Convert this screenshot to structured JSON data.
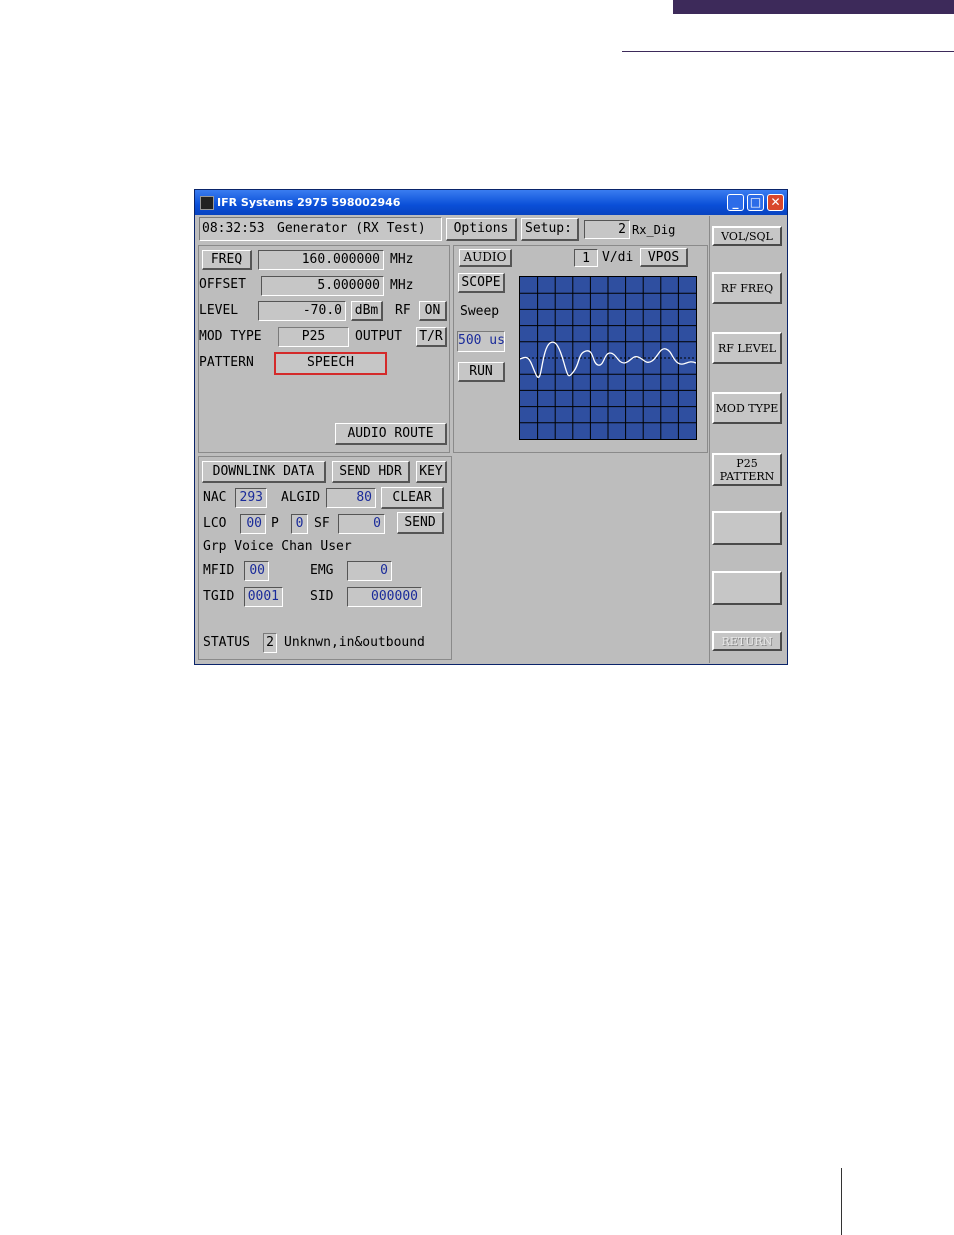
{
  "window": {
    "title": "IFR Systems 2975 598002946"
  },
  "toolbar": {
    "time": "08:32:53",
    "mode": "Generator (RX Test)",
    "options": "Options",
    "setup": "Setup:",
    "setup_value": "2",
    "setup_name": "Rx_Dig"
  },
  "gen": {
    "freq_btn": "FREQ",
    "freq_value": "160.000000",
    "freq_unit": "MHz",
    "offset_label": "OFFSET",
    "offset_value": "5.000000",
    "offset_unit": "MHz",
    "level_label": "LEVEL",
    "level_value": "-70.0",
    "level_unit": "dBm",
    "rf_label": "RF",
    "rf_value": "ON",
    "modtype_label": "MOD TYPE",
    "modtype_value": "P25",
    "output_label": "OUTPUT",
    "output_value": "T/R",
    "pattern_label": "PATTERN",
    "pattern_value": "SPEECH",
    "audio_route": "AUDIO ROUTE"
  },
  "scope": {
    "audio_btn": "AUDIO",
    "scope_btn": "SCOPE",
    "sweep_label": "Sweep",
    "sweep_value": "500 us",
    "run_btn": "RUN",
    "vdiv_value": "1",
    "vdiv_label": "V/di",
    "vpos_btn": "VPOS",
    "trace_color": "#ffffff",
    "grid_color": "#000000",
    "bg_color": "#2f4fa0"
  },
  "p25": {
    "downlink_btn": "DOWNLINK DATA",
    "send_hdr_btn": "SEND HDR",
    "key_btn": "KEY",
    "nac_label": "NAC",
    "nac_value": "293",
    "algid_label": "ALGID",
    "algid_value": "80",
    "clear_btn": "CLEAR",
    "lco_label": "LCO",
    "lco_value": "00",
    "p_label": "P",
    "p_value": "0",
    "sf_label": "SF",
    "sf_value": "0",
    "send_btn": "SEND",
    "lco_desc": "Grp Voice Chan User",
    "mfid_label": "MFID",
    "mfid_value": "00",
    "emg_label": "EMG",
    "emg_value": "0",
    "tgid_label": "TGID",
    "tgid_value": "0001",
    "sid_label": "SID",
    "sid_value": "000000",
    "status_label": "STATUS",
    "status_value": "2",
    "status_text": "Unknwn,in&outbound"
  },
  "softkeys": {
    "vol_sql": "VOL/SQL",
    "rf_freq": "RF FREQ",
    "rf_level": "RF LEVEL",
    "mod_type": "MOD TYPE",
    "p25_line1": "P25",
    "p25_line2": "PATTERN",
    "return": "RETURN"
  },
  "colors": {
    "highlight": "#d42a2a",
    "title_bar": "#0a4fd8",
    "accent_bar": "#3d2a5a"
  }
}
